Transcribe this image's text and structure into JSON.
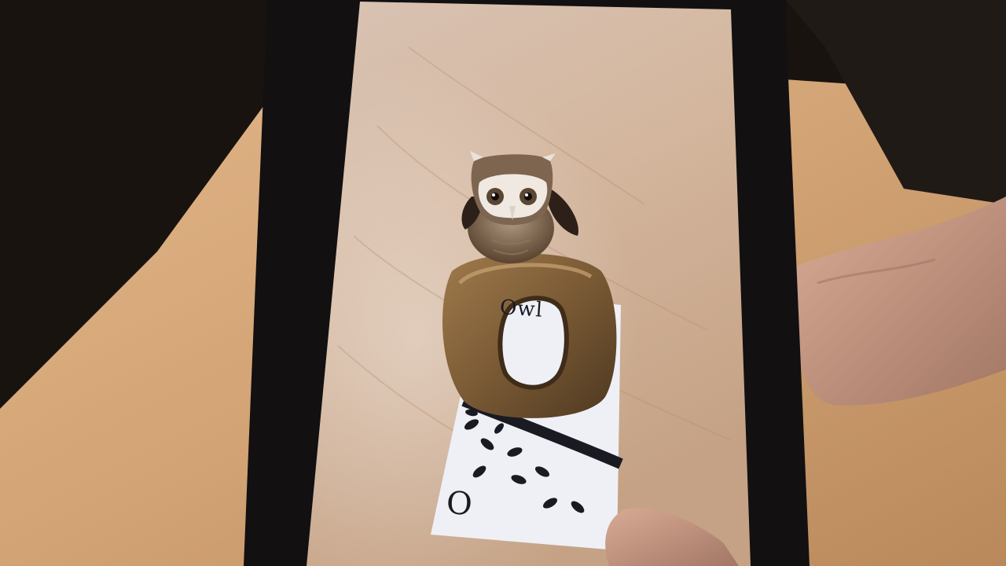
{
  "scene": {
    "subject": "owl",
    "card": {
      "word": "Owl",
      "letter": "O"
    }
  },
  "colors": {
    "table_wood": "#d6a778",
    "tablet_frame": "#121011",
    "letter_bronze": "#7a5a35",
    "owl_feather": "#6d5640",
    "card_paper": "#eef0f6",
    "ink": "#1a1a22",
    "skin": "#c99b86"
  }
}
